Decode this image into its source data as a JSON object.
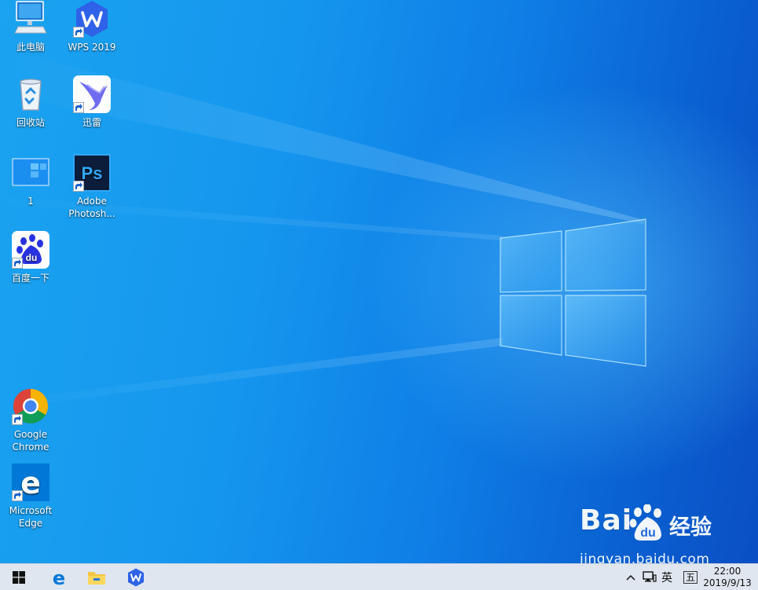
{
  "desktop": {
    "icons": [
      {
        "label": "此电脑",
        "shortcut": false,
        "icon": "computer-icon"
      },
      {
        "label": "WPS 2019",
        "shortcut": true,
        "icon": "wps-icon"
      },
      {
        "label": "回收站",
        "shortcut": false,
        "icon": "recycle-bin-icon"
      },
      {
        "label": "迅雷",
        "shortcut": true,
        "icon": "thunder-icon"
      },
      {
        "label": "1",
        "shortcut": false,
        "icon": "image-file-icon"
      },
      {
        "label": "Adobe Photosh...",
        "shortcut": true,
        "icon": "photoshop-icon",
        "lines": [
          "Adobe",
          "Photosh..."
        ]
      },
      {
        "label": "百度一下",
        "shortcut": true,
        "icon": "baidu-icon"
      },
      {
        "label": "Google Chrome",
        "shortcut": true,
        "icon": "chrome-icon",
        "lines": [
          "Google",
          "Chrome"
        ]
      },
      {
        "label": "Microsoft Edge",
        "shortcut": true,
        "icon": "edge-icon",
        "lines": [
          "Microsoft",
          "Edge"
        ]
      }
    ]
  },
  "watermark": {
    "logo_text": "Bai",
    "logo_text2": "du",
    "cn_text": "经验",
    "url": "jingyan.baidu.com"
  },
  "taskbar": {
    "pinned": [
      "start-icon",
      "edge-icon",
      "file-explorer-icon",
      "wps-icon"
    ],
    "tray": {
      "chevron": "^",
      "ime_lang": "英",
      "ime_mode": "五"
    },
    "clock": {
      "time": "22:00",
      "date": "2019/9/13"
    }
  },
  "colors": {
    "accent": "#0078d7",
    "taskbar": "#dfe6ef",
    "wps_blue": "#2f62e8",
    "photoshop_bg": "#0b1d3a",
    "photoshop_text": "#31a8ff",
    "baidu_blue": "#2932e1"
  }
}
